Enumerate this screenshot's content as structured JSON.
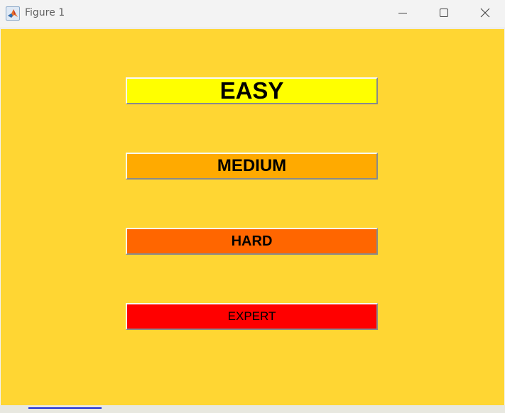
{
  "window": {
    "title": "Figure 1",
    "icon": "matlab-logo-icon",
    "controls": [
      "minimize-icon",
      "maximize-icon",
      "close-icon"
    ]
  },
  "figure": {
    "background_color": "#ffd633"
  },
  "buttons": [
    {
      "label": "EASY",
      "color": "#ffff00"
    },
    {
      "label": "MEDIUM",
      "color": "#ffaa00"
    },
    {
      "label": "HARD",
      "color": "#ff6600"
    },
    {
      "label": "EXPERT",
      "color": "#ff0000"
    }
  ]
}
